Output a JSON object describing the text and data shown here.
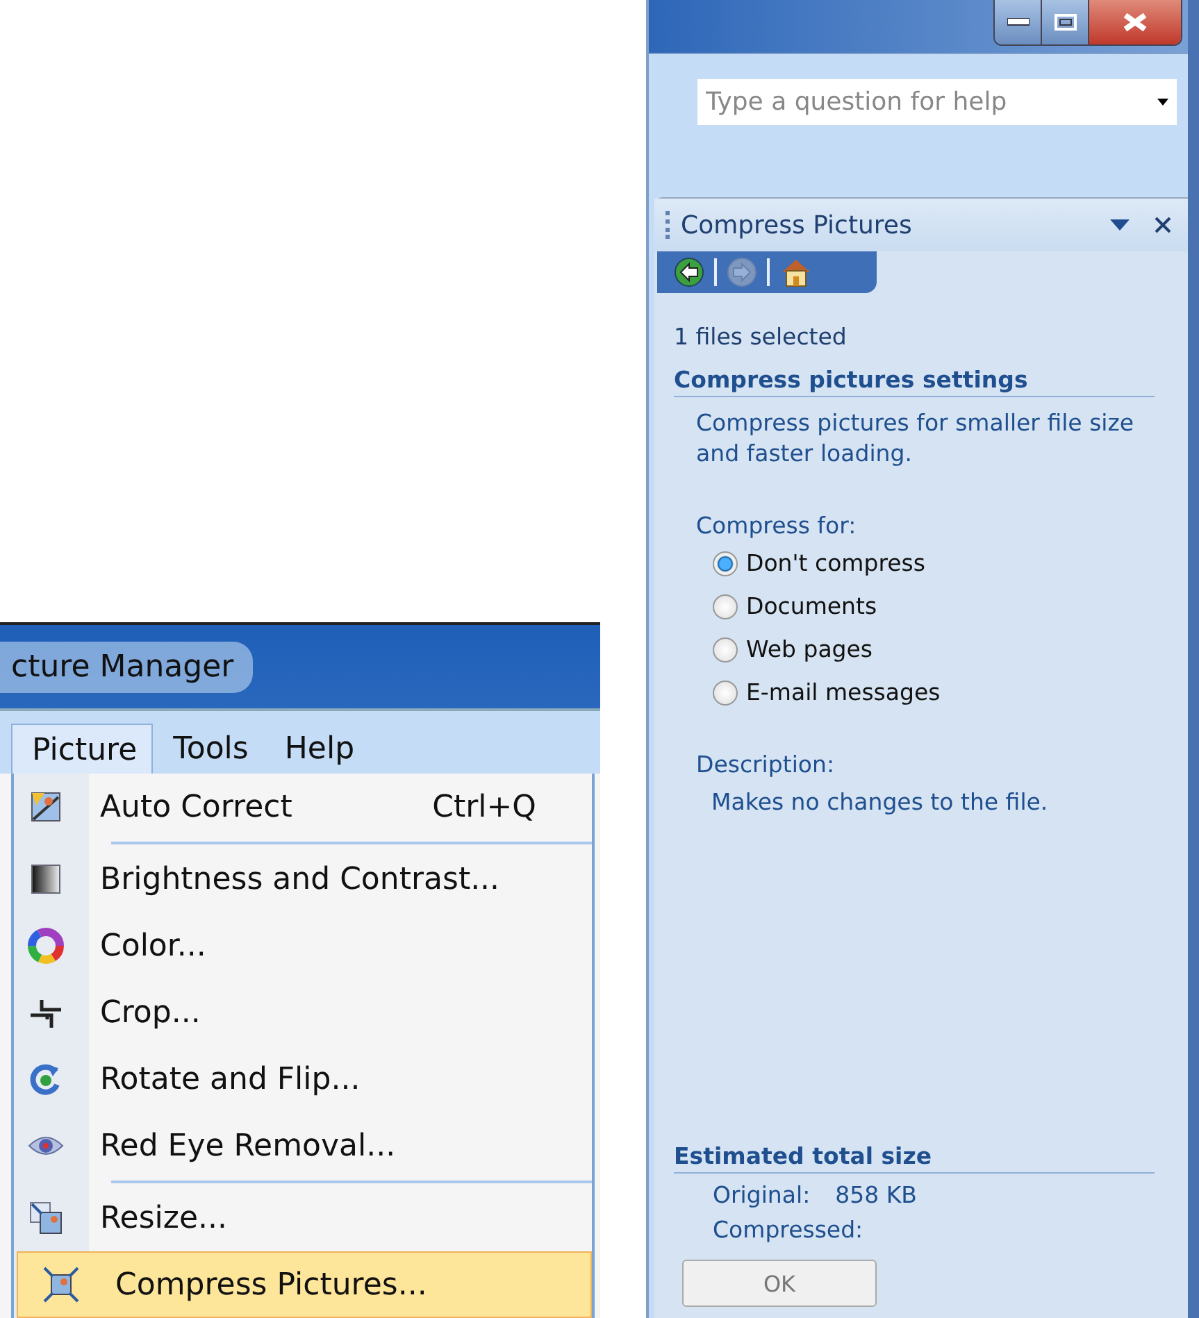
{
  "menu_window": {
    "title": "cture Manager",
    "menubar": [
      {
        "label": "Picture",
        "selected": true
      },
      {
        "label": "Tools",
        "selected": false
      },
      {
        "label": "Help",
        "selected": false
      }
    ],
    "menu_items": [
      {
        "kind": "autocorrect",
        "label": "Auto Correct",
        "shortcut": "Ctrl+Q",
        "separator_before": false,
        "selected": false
      },
      {
        "kind": "brightness",
        "label": "Brightness and Contrast...",
        "separator_before": true,
        "selected": false
      },
      {
        "kind": "color",
        "label": "Color...",
        "separator_before": false,
        "selected": false
      },
      {
        "kind": "crop",
        "label": "Crop...",
        "separator_before": false,
        "selected": false
      },
      {
        "kind": "rotate",
        "label": "Rotate and Flip...",
        "separator_before": false,
        "selected": false
      },
      {
        "kind": "redeye",
        "label": "Red Eye Removal...",
        "separator_before": false,
        "selected": false
      },
      {
        "kind": "resize",
        "label": "Resize...",
        "separator_before": true,
        "selected": false
      },
      {
        "kind": "compress",
        "label": "Compress Pictures...",
        "separator_before": false,
        "selected": true
      }
    ]
  },
  "help_field": {
    "placeholder": "Type a question for help"
  },
  "task_pane": {
    "title": "Compress Pictures",
    "nav": [
      {
        "kind": "back",
        "disabled": false
      },
      {
        "kind": "forward",
        "disabled": true
      },
      {
        "kind": "home",
        "disabled": false
      }
    ],
    "selection_info": "1 files selected",
    "settings_heading": "Compress pictures settings",
    "settings_text": "Compress pictures for smaller file size and faster loading.",
    "compress_for_label": "Compress for:",
    "options": [
      {
        "label": "Don't compress",
        "selected": true
      },
      {
        "label": "Documents",
        "selected": false
      },
      {
        "label": "Web pages",
        "selected": false
      },
      {
        "label": "E-mail messages",
        "selected": false
      }
    ],
    "description_label": "Description:",
    "description": "Makes no changes to the file.",
    "size_heading": "Estimated total size",
    "original_label": "Original:",
    "original_value": "858 KB",
    "compressed_label": "Compressed:",
    "ok_button": {
      "label": "OK",
      "disabled": true
    }
  }
}
